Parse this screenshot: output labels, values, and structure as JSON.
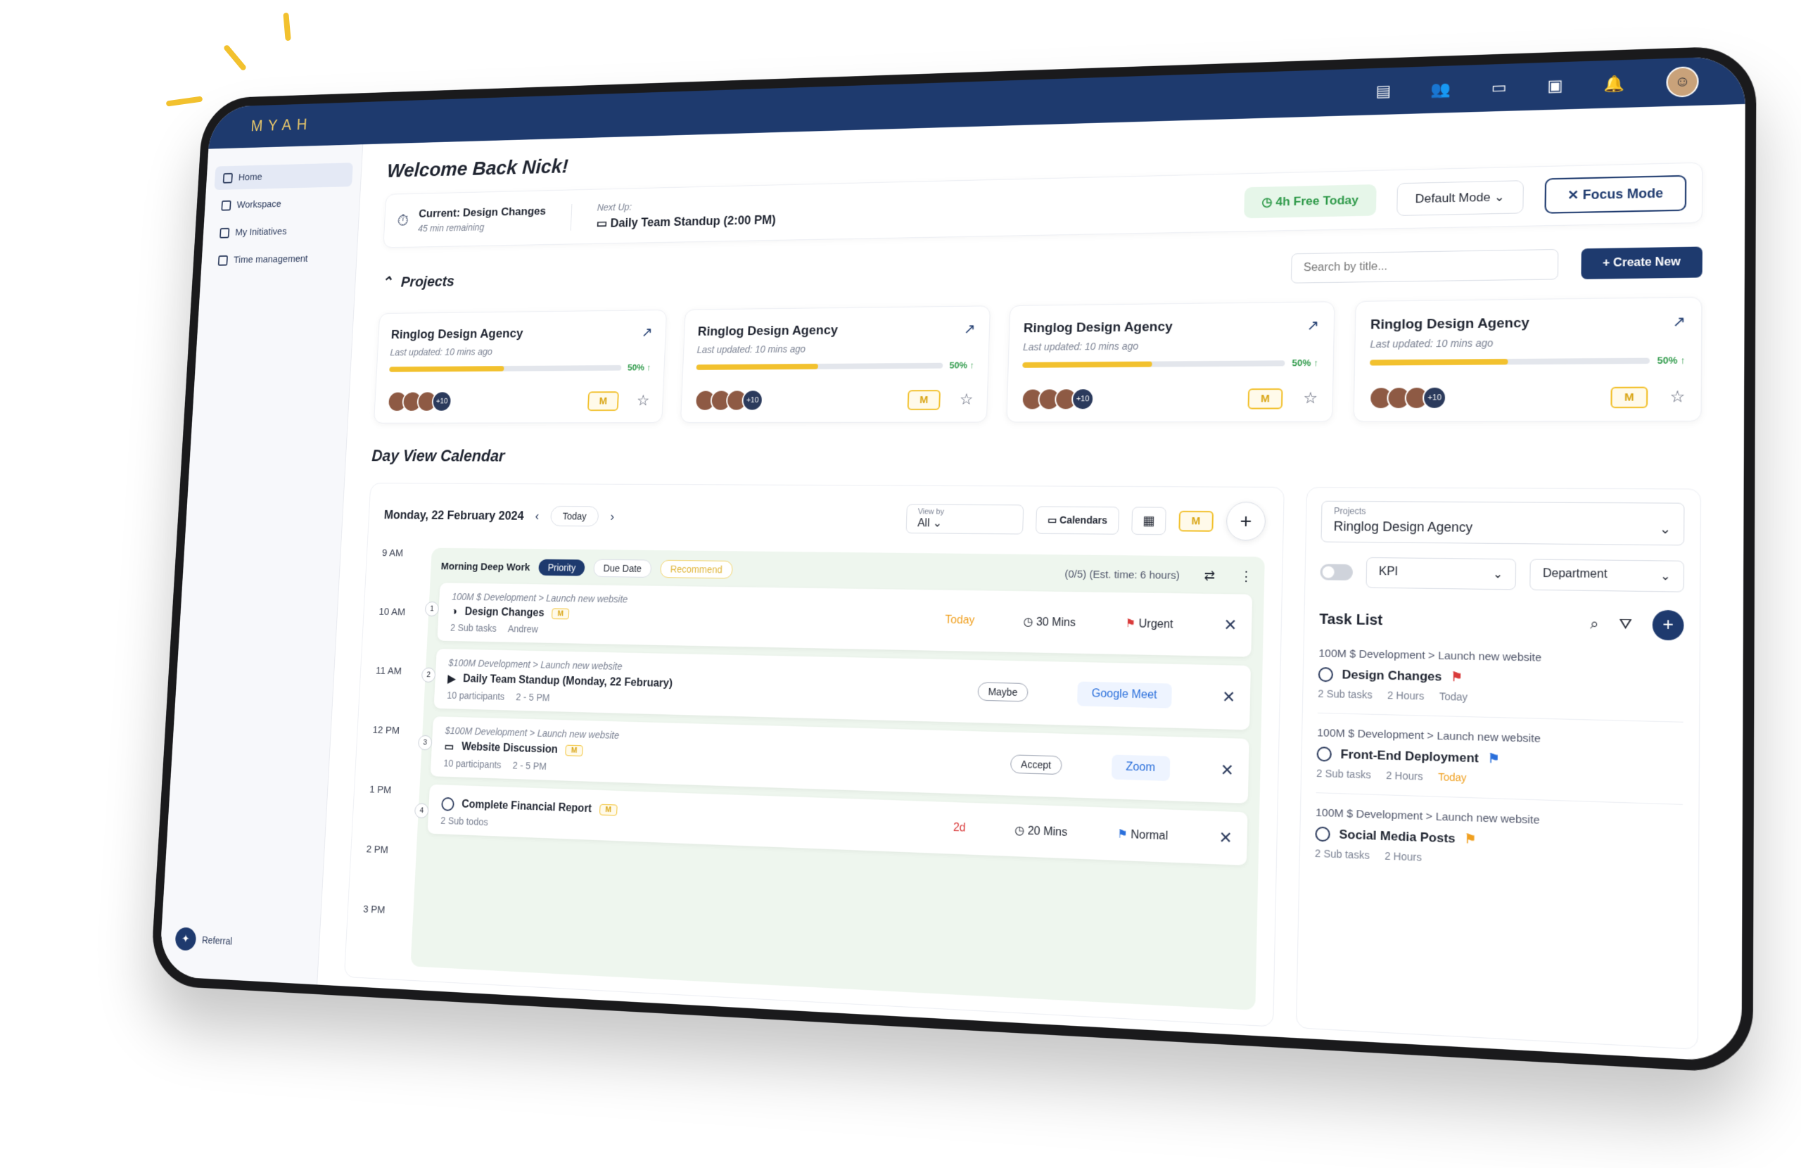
{
  "app": {
    "logo": "MYAH"
  },
  "colors": {
    "brand": "#1e3a6e",
    "accent": "#f2c12e",
    "success": "#2f9a4a",
    "danger": "#d93a3a"
  },
  "topbar": {
    "icons": [
      "clipboard-icon",
      "users-icon",
      "ticket-icon",
      "chat-icon",
      "bell-icon"
    ]
  },
  "sidebar": {
    "items": [
      {
        "label": "Home"
      },
      {
        "label": "Workspace"
      },
      {
        "label": "My Initiatives"
      },
      {
        "label": "Time management"
      }
    ],
    "referral": "Referral"
  },
  "welcome": "Welcome Back Nick!",
  "status": {
    "current": "Current: Design Changes",
    "remaining": "45 min remaining",
    "next_label": "Next Up:",
    "next_title": "Daily Team Standup (2:00 PM)",
    "free": "4h Free Today",
    "mode": "Default Mode",
    "focus": "Focus Mode"
  },
  "projects": {
    "title": "Projects",
    "search_placeholder": "Search by title...",
    "create": "Create New",
    "cards": [
      {
        "name": "Ringlog Design Agency",
        "updated": "Last updated: 10 mins ago",
        "progress": 50,
        "pct": "50%",
        "more": "+10",
        "chip": "M"
      },
      {
        "name": "Ringlog Design Agency",
        "updated": "Last updated: 10 mins ago",
        "progress": 50,
        "pct": "50%",
        "more": "+10",
        "chip": "M"
      },
      {
        "name": "Ringlog Design Agency",
        "updated": "Last updated: 10 mins ago",
        "progress": 50,
        "pct": "50%",
        "more": "+10",
        "chip": "M"
      },
      {
        "name": "Ringlog Design Agency",
        "updated": "Last updated: 10 mins ago",
        "progress": 50,
        "pct": "50%",
        "more": "+10",
        "chip": "M"
      }
    ]
  },
  "calendar": {
    "title": "Day View Calendar",
    "date": "Monday, 22 February 2024",
    "today": "Today",
    "viewby_label": "View by",
    "viewby_value": "All",
    "calendars": "Calendars",
    "hours": [
      "9 AM",
      "10 AM",
      "11 AM",
      "12 PM",
      "1 PM",
      "2 PM",
      "3 PM"
    ],
    "block": {
      "name": "Morning Deep Work",
      "priority": "Priority",
      "due": "Due Date",
      "recommend": "Recommend",
      "meta": "(0/5)  (Est. time: 6 hours)"
    },
    "tasks": [
      {
        "num": "1",
        "crumb": "100M $ Development  >  Launch new website",
        "title": "Design Changes",
        "sub1": "2 Sub tasks",
        "sub2": "Andrew",
        "c1": "Today",
        "c2": "30 Mins",
        "c3": "Urgent"
      },
      {
        "num": "2",
        "crumb": "$100M Development  >  Launch new website",
        "title": "Daily Team Standup (Monday, 22 February)",
        "sub1": "10 participants",
        "sub2": "2 - 5 PM",
        "c1": "Maybe",
        "c2": "Google Meet",
        "c3": ""
      },
      {
        "num": "3",
        "crumb": "$100M Development  >  Launch new website",
        "title": "Website Discussion",
        "sub1": "10 participants",
        "sub2": "2 - 5 PM",
        "c1": "Accept",
        "c2": "Zoom",
        "c3": ""
      },
      {
        "num": "4",
        "crumb": "",
        "title": "Complete Financial Report",
        "sub1": "2 Sub todos",
        "sub2": "",
        "c1": "2d",
        "c2": "20 Mins",
        "c3": "Normal"
      }
    ]
  },
  "task_panel": {
    "projects_label": "Projects",
    "projects_value": "Ringlog Design Agency",
    "kpi": "KPI",
    "department": "Department",
    "title": "Task List",
    "items": [
      {
        "crumb": "100M $ Development  >  Launch new website",
        "name": "Design Changes",
        "sub": "2 Sub tasks",
        "hours": "2 Hours",
        "when": "Today"
      },
      {
        "crumb": "100M $ Development  >  Launch new website",
        "name": "Front-End Deployment",
        "sub": "2 Sub tasks",
        "hours": "2 Hours",
        "when": "Today"
      },
      {
        "crumb": "100M $ Development  >  Launch new website",
        "name": "Social Media Posts",
        "sub": "2 Sub tasks",
        "hours": "2 Hours",
        "when": ""
      }
    ]
  }
}
